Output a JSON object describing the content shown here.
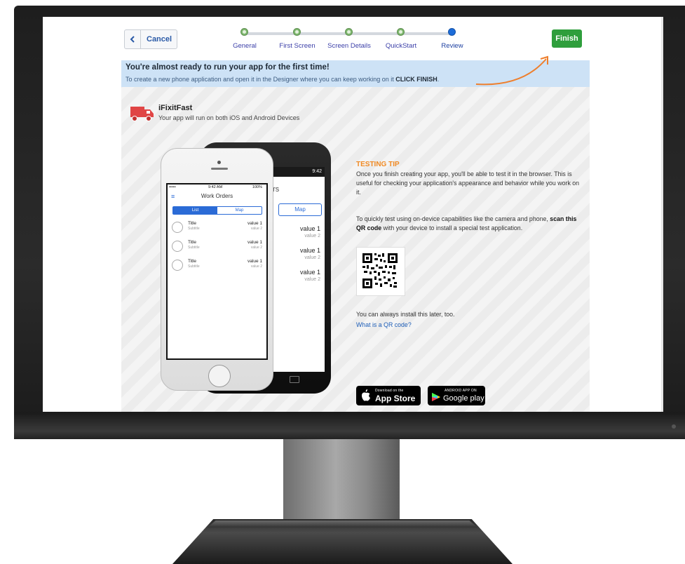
{
  "toolbar": {
    "cancel_label": "Cancel",
    "finish_label": "Finish"
  },
  "wizard_steps": [
    {
      "label": "General",
      "state": "done"
    },
    {
      "label": "First Screen",
      "state": "done"
    },
    {
      "label": "Screen Details",
      "state": "done"
    },
    {
      "label": "QuickStart",
      "state": "done"
    },
    {
      "label": "Review",
      "state": "current"
    }
  ],
  "banner": {
    "title": "You're almost ready to run your app for the first time!",
    "subtitle": "To create a new phone application and open it in the Designer where you can keep working on it",
    "subtitle_emphasis": "CLICK FINISH",
    "subtitle_end": "."
  },
  "app": {
    "name": "iFixitFast",
    "description": "Your app will run on both iOS and Android Devices"
  },
  "iphone_preview": {
    "status_left": "•••••",
    "status_time": "9:42 AM",
    "status_battery": "100%",
    "title": "Work Orders",
    "segment_list": "List",
    "segment_map": "Map",
    "rows": [
      {
        "title": "Title",
        "subtitle": "Subtitle",
        "value1": "value 1",
        "value2": "value 2"
      },
      {
        "title": "Title",
        "subtitle": "Subtitle",
        "value1": "value 1",
        "value2": "value 2"
      },
      {
        "title": "Title",
        "subtitle": "Subtitle",
        "value1": "value 1",
        "value2": "value 2"
      }
    ]
  },
  "android_preview": {
    "status": "9:42",
    "title_partial": "ers",
    "segment_map": "Map",
    "rows": [
      {
        "value1": "value 1",
        "value2": "value 2"
      },
      {
        "value1": "value 1",
        "value2": "value 2"
      },
      {
        "value1": "value 1",
        "value2": "value 2"
      }
    ]
  },
  "testing_tip": {
    "title": "TESTING TIP",
    "paragraph1": "Once you finish creating your app, you'll be able to test it in the browser. This is useful for checking your application's appearance and behavior while you work on it.",
    "paragraph2_start": "To quickly test using on-device capabilities like the camera and phone,",
    "paragraph2_bold": "scan this QR code",
    "paragraph2_end": "with your device to install a special test application.",
    "later_text": "You can always install this later, too.",
    "qr_link": "What is a QR code?"
  },
  "store_badges": {
    "appstore_small": "Download on the",
    "appstore_big": "App Store",
    "google_small": "ANDROID APP ON",
    "google_big": "Google play"
  },
  "colors": {
    "finish_green": "#2f9e3c",
    "step_done": "#7fb86f",
    "step_current": "#1c6cd9",
    "banner_bg": "#cde2f6",
    "tip_orange": "#f08a24",
    "link_blue": "#1f5fb8"
  }
}
